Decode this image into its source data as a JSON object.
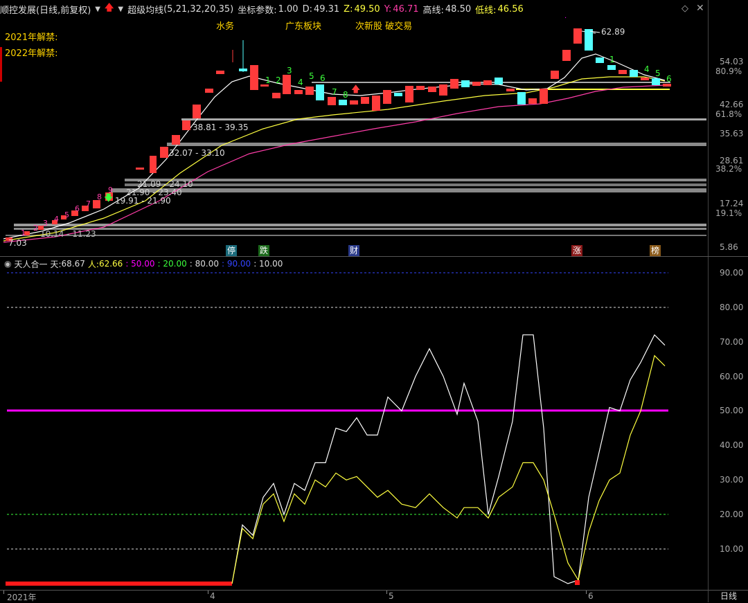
{
  "header": {
    "stock_name": "顺控发展",
    "period_label": "(日线,前复权)",
    "indicator_name": "超级均线",
    "indicator_params": "(5,21,32,20,35)",
    "coord_label": "坐标参数:",
    "coord_value": "1.00",
    "d_label": "D:",
    "d_value": "49.31",
    "z_label": "Z:",
    "z_value": "49.50",
    "y_label": "Y:",
    "y_value": "46.71",
    "high_label": "高线:",
    "high_value": "48.50",
    "low_label": "低线:",
    "low_value": "46.56"
  },
  "unlock_labels": [
    "2021年解禁:",
    "2022年解禁:"
  ],
  "concept_tags": [
    "水务",
    "广东板块",
    "次新股 破交易"
  ],
  "price_axis": [
    "54.03",
    "80.9%",
    "42.66",
    "61.8%",
    "35.63",
    "28.61",
    "38.2%",
    "17.24",
    "19.1%",
    "5.86"
  ],
  "price_annotations": [
    "62.89",
    "38.81 - 39.35",
    "32.07 - 33.10",
    "21.09 - 24.10",
    "21.90 - 23.40",
    "19.91 - 21.90",
    "10.14 - 11.23",
    "7.03"
  ],
  "events": [
    "停",
    "跌",
    "财",
    "涨",
    "榜"
  ],
  "indicator_header": {
    "name": "天人合一",
    "tian_label": "天:",
    "tian_value": "68.67",
    "ren_label": "人:",
    "ren_value": "62.66",
    "l1": ": 50.00",
    "l2": ": 20.00",
    "l3": ": 80.00",
    "l4": ": 90.00",
    "l5": ": 10.00"
  },
  "indicator_axis": [
    "90.00",
    "80.00",
    "70.00",
    "60.00",
    "50.00",
    "40.00",
    "30.00",
    "20.00",
    "10.00"
  ],
  "date_axis": [
    "2021年",
    "4",
    "5",
    "6"
  ],
  "period_button": "日线",
  "colors": {
    "up": "#ff3b3b",
    "down": "#54ffff",
    "ma_white": "#ffffff",
    "ma_yellow": "#ffff40",
    "ma_pink": "#ff3da8",
    "magenta": "#ff00ff",
    "yellow": "#ffd400"
  },
  "indicator_series": {
    "tian": [
      0,
      0,
      0,
      0,
      0,
      0,
      0,
      0,
      0,
      0,
      0,
      0,
      0,
      0,
      0,
      0,
      0,
      0,
      0,
      0,
      0,
      0,
      0,
      0,
      0,
      0,
      0,
      0,
      0,
      0,
      0,
      0,
      0,
      0,
      0,
      0,
      0,
      0,
      0,
      0,
      0,
      0,
      0,
      0,
      0,
      0,
      0,
      0,
      0,
      0,
      0,
      0,
      0,
      0,
      0,
      0,
      0,
      0,
      0,
      0,
      0,
      0,
      0,
      0,
      0,
      0,
      0,
      0,
      0,
      0,
      0,
      0,
      0,
      0,
      0,
      0,
      0,
      0,
      0,
      0,
      0,
      0,
      0,
      0,
      0,
      0,
      0,
      0,
      0,
      0,
      0,
      0,
      0,
      0,
      0,
      0,
      0,
      0,
      0,
      0
    ],
    "tian_points": [
      [
        335,
        0
      ],
      [
        350,
        17
      ],
      [
        365,
        14
      ],
      [
        380,
        25
      ],
      [
        395,
        29
      ],
      [
        410,
        20
      ],
      [
        425,
        29
      ],
      [
        440,
        27
      ],
      [
        455,
        35
      ],
      [
        470,
        35
      ],
      [
        485,
        45
      ],
      [
        500,
        44
      ],
      [
        515,
        48
      ],
      [
        530,
        43
      ],
      [
        545,
        43
      ],
      [
        560,
        54
      ],
      [
        580,
        50
      ],
      [
        600,
        60
      ],
      [
        620,
        68
      ],
      [
        640,
        60
      ],
      [
        660,
        49
      ],
      [
        670,
        58
      ],
      [
        690,
        47
      ],
      [
        705,
        20
      ],
      [
        720,
        31
      ],
      [
        740,
        47
      ],
      [
        755,
        72
      ],
      [
        770,
        72
      ],
      [
        785,
        45
      ],
      [
        800,
        2
      ],
      [
        820,
        0
      ],
      [
        835,
        1
      ],
      [
        850,
        25
      ],
      [
        865,
        38
      ],
      [
        880,
        51
      ],
      [
        895,
        50
      ],
      [
        910,
        59
      ],
      [
        925,
        64
      ],
      [
        945,
        72
      ],
      [
        960,
        69
      ]
    ],
    "ren_points": [
      [
        335,
        0
      ],
      [
        350,
        16
      ],
      [
        365,
        13
      ],
      [
        380,
        23
      ],
      [
        395,
        26
      ],
      [
        410,
        18
      ],
      [
        425,
        26
      ],
      [
        440,
        23
      ],
      [
        455,
        30
      ],
      [
        470,
        28
      ],
      [
        485,
        32
      ],
      [
        500,
        30
      ],
      [
        515,
        31
      ],
      [
        530,
        28
      ],
      [
        545,
        25
      ],
      [
        560,
        27
      ],
      [
        580,
        23
      ],
      [
        600,
        22
      ],
      [
        620,
        26
      ],
      [
        640,
        22
      ],
      [
        660,
        19
      ],
      [
        670,
        22
      ],
      [
        690,
        22
      ],
      [
        705,
        19
      ],
      [
        720,
        25
      ],
      [
        740,
        28
      ],
      [
        755,
        35
      ],
      [
        770,
        35
      ],
      [
        785,
        30
      ],
      [
        800,
        20
      ],
      [
        820,
        6
      ],
      [
        835,
        1
      ],
      [
        850,
        15
      ],
      [
        865,
        24
      ],
      [
        880,
        30
      ],
      [
        895,
        32
      ],
      [
        910,
        43
      ],
      [
        925,
        50
      ],
      [
        945,
        66
      ],
      [
        960,
        63
      ]
    ]
  }
}
